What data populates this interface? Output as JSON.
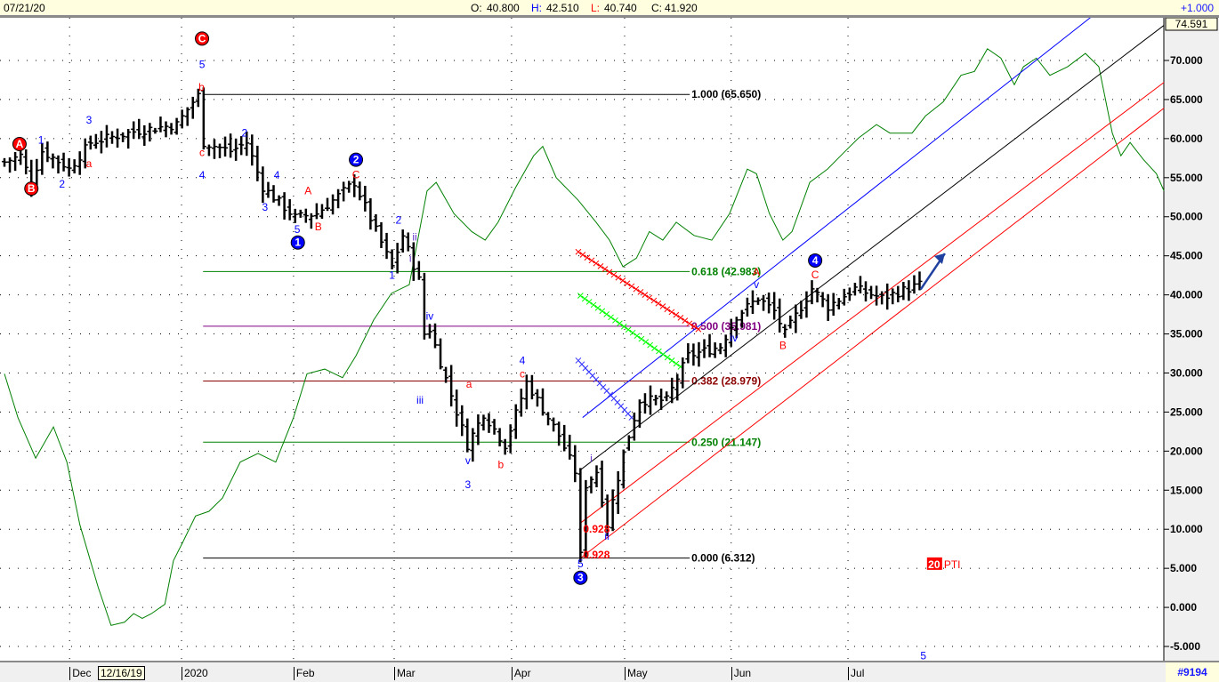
{
  "header": {
    "date": "07/21/20",
    "open_label": "O:",
    "open": "40.800",
    "high_label": "H:",
    "high": "42.510",
    "low_label": "L:",
    "low": "40.740",
    "close_label": "C:",
    "close": "41.920",
    "change": "+1.000"
  },
  "footer": {
    "cursor_date": "12/16/19",
    "series_id": "#9194"
  },
  "chart_data": {
    "type": "ohlc",
    "ylim": [
      -6.3,
      74.591
    ],
    "y_top_label": "74.591",
    "yticks": [
      70,
      65,
      60,
      55,
      50,
      45,
      40,
      35,
      30,
      25,
      20,
      15,
      10,
      5,
      0,
      -5
    ],
    "ytick_labels": [
      "70.000",
      "65.000",
      "60.000",
      "55.000",
      "50.000",
      "45.000",
      "40.000",
      "35.000",
      "30.000",
      "25.000",
      "20.000",
      "15.000",
      "10.000",
      "5.000",
      "0.000",
      "-5.000"
    ],
    "xlim": [
      0,
      215.5
    ],
    "month_ticks": [
      {
        "label": "Dec",
        "idx": 12.1
      },
      {
        "label": "2020",
        "idx": 32.9
      },
      {
        "label": "Feb",
        "idx": 53.7
      },
      {
        "label": "Mar",
        "idx": 72.4
      },
      {
        "label": "Apr",
        "idx": 94.2
      },
      {
        "label": "May",
        "idx": 115.2
      },
      {
        "label": "Jun",
        "idx": 135
      },
      {
        "label": "Jul",
        "idx": 156.7
      }
    ],
    "price_pivots": [
      [
        0,
        57.0
      ],
      [
        3,
        57.8
      ],
      [
        5,
        54.4
      ],
      [
        7,
        58.4
      ],
      [
        11,
        56.7
      ],
      [
        12,
        56.1
      ],
      [
        16,
        59.5
      ],
      [
        24,
        60.9
      ],
      [
        32,
        61.8
      ],
      [
        35,
        64.7
      ],
      [
        36,
        65.5
      ],
      [
        37,
        59.5
      ],
      [
        42,
        58.4
      ],
      [
        45,
        59.5
      ],
      [
        48,
        53.8
      ],
      [
        54,
        49.9
      ],
      [
        58,
        50.4
      ],
      [
        61,
        52.1
      ],
      [
        65,
        54.4
      ],
      [
        72,
        43.6
      ],
      [
        74,
        47.6
      ],
      [
        77,
        41.9
      ],
      [
        78,
        35.0
      ],
      [
        79,
        35.6
      ],
      [
        86,
        20.8
      ],
      [
        89,
        24.8
      ],
      [
        93,
        20.8
      ],
      [
        97,
        28.8
      ],
      [
        103,
        22.0
      ],
      [
        106,
        17.4
      ],
      [
        107,
        6.6
      ],
      [
        108,
        15.7
      ],
      [
        110,
        17.4
      ],
      [
        112,
        10.6
      ],
      [
        115,
        19.7
      ],
      [
        118,
        26.5
      ],
      [
        123,
        26.5
      ],
      [
        127,
        32.2
      ],
      [
        133,
        33.4
      ],
      [
        136,
        37.3
      ],
      [
        140,
        39.6
      ],
      [
        143,
        37.9
      ],
      [
        145,
        35.0
      ],
      [
        150,
        40.8
      ],
      [
        153,
        38.5
      ],
      [
        158,
        40.8
      ],
      [
        163,
        39.6
      ],
      [
        170,
        41.3
      ]
    ],
    "indicator_line": {
      "color": "#008000",
      "points": [
        [
          0,
          29.9
        ],
        [
          2.5,
          24.3
        ],
        [
          5.8,
          19.1
        ],
        [
          9.1,
          23.1
        ],
        [
          11.6,
          18.6
        ],
        [
          14,
          10.6
        ],
        [
          17.4,
          2.6
        ],
        [
          19.8,
          -2.3
        ],
        [
          22.3,
          -1.9
        ],
        [
          24,
          -0.8
        ],
        [
          25.6,
          -1.4
        ],
        [
          27.3,
          -0.8
        ],
        [
          29.8,
          0.4
        ],
        [
          31.4,
          6.0
        ],
        [
          33.1,
          8.3
        ],
        [
          35.5,
          11.7
        ],
        [
          38,
          12.3
        ],
        [
          40.5,
          14.0
        ],
        [
          43.8,
          18.6
        ],
        [
          47.1,
          19.7
        ],
        [
          50.4,
          18.6
        ],
        [
          53.7,
          24.3
        ],
        [
          56.2,
          29.9
        ],
        [
          59.5,
          30.5
        ],
        [
          62.8,
          29.4
        ],
        [
          65.3,
          32.2
        ],
        [
          68.6,
          36.8
        ],
        [
          71.9,
          40.2
        ],
        [
          75.2,
          41.3
        ],
        [
          78.5,
          53.3
        ],
        [
          80.2,
          54.4
        ],
        [
          83.5,
          50.4
        ],
        [
          86.8,
          48.1
        ],
        [
          89.3,
          47.0
        ],
        [
          91.7,
          49.3
        ],
        [
          95,
          53.8
        ],
        [
          98.3,
          57.8
        ],
        [
          100,
          59.0
        ],
        [
          102.5,
          55.0
        ],
        [
          106.6,
          52.1
        ],
        [
          109.9,
          49.3
        ],
        [
          112.4,
          47.0
        ],
        [
          114.9,
          43.6
        ],
        [
          117.4,
          44.7
        ],
        [
          119.8,
          48.1
        ],
        [
          122.3,
          47.0
        ],
        [
          124.8,
          49.3
        ],
        [
          128.1,
          47.6
        ],
        [
          131.4,
          47.0
        ],
        [
          134.7,
          50.4
        ],
        [
          138,
          56.1
        ],
        [
          139.7,
          55.5
        ],
        [
          142.1,
          50.4
        ],
        [
          144.6,
          47.0
        ],
        [
          146.3,
          48.1
        ],
        [
          149.6,
          54.4
        ],
        [
          152.9,
          56.1
        ],
        [
          156.2,
          58.4
        ],
        [
          158.7,
          60.1
        ],
        [
          162,
          61.8
        ],
        [
          164.5,
          60.7
        ],
        [
          168.6,
          60.7
        ],
        [
          171.1,
          62.9
        ],
        [
          174.4,
          64.7
        ],
        [
          177.7,
          68.1
        ],
        [
          180.2,
          68.6
        ],
        [
          182.6,
          71.5
        ],
        [
          185.1,
          70.3
        ],
        [
          187.6,
          66.9
        ],
        [
          189.3,
          69.2
        ],
        [
          191.7,
          70.3
        ],
        [
          194.2,
          68.1
        ],
        [
          197.5,
          69.2
        ],
        [
          200.8,
          70.9
        ],
        [
          203.3,
          69.2
        ],
        [
          205.8,
          60.7
        ],
        [
          207.4,
          57.8
        ],
        [
          209.1,
          59.5
        ],
        [
          211.6,
          57.3
        ],
        [
          214,
          55.5
        ],
        [
          215.4,
          53.3
        ]
      ]
    },
    "fib_levels": [
      {
        "ratio": "1.000",
        "value": 65.65,
        "label": "1.000 (65.650)",
        "color": "#000000",
        "text_color": "#000000"
      },
      {
        "ratio": "0.618",
        "value": 42.983,
        "label": "0.618 (42.983)",
        "color": "#008000",
        "text_color": "#008000"
      },
      {
        "ratio": "0.500",
        "value": 35.981,
        "label": "0.500 (35.981)",
        "color": "#800080",
        "text_color": "#800080"
      },
      {
        "ratio": "0.382",
        "value": 28.979,
        "label": "0.382 (28.979)",
        "color": "#8b0000",
        "text_color": "#8b0000"
      },
      {
        "ratio": "0.250",
        "value": 21.147,
        "label": "0.250 (21.147)",
        "color": "#008000",
        "text_color": "#008000"
      },
      {
        "ratio": "0.000",
        "value": 6.312,
        "label": "0.000 (6.312)",
        "color": "#000000",
        "text_color": "#000000"
      }
    ],
    "fib_range_idx": [
      36.9,
      127.3
    ],
    "channel_lines": [
      {
        "color": "#0000ff",
        "from": [
          107.4,
          24.3
        ],
        "to": [
          205.8,
          77.7
        ]
      },
      {
        "color": "#000000",
        "from": [
          107,
          17.6
        ],
        "to": [
          215.4,
          74.5
        ]
      },
      {
        "color": "#ff0000",
        "from": [
          107,
          10.8
        ],
        "to": [
          215.4,
          67.2
        ]
      },
      {
        "color": "#ff0000",
        "from": [
          107,
          6.3
        ],
        "to": [
          215.4,
          63.9
        ]
      }
    ],
    "speed_lines": [
      {
        "color": "#ff0000",
        "from": [
          106.6,
          45.5
        ],
        "to": [
          128.9,
          35.6
        ]
      },
      {
        "color": "#00ff00",
        "from": [
          107,
          39.9
        ],
        "to": [
          125.6,
          30.8
        ]
      },
      {
        "color": "#3333ff",
        "from": [
          106.6,
          31.6
        ],
        "to": [
          116.5,
          24.3
        ]
      }
    ],
    "projection_arrow": {
      "color": "#2040a0",
      "from": [
        170.2,
        40.7
      ],
      "to": [
        174.7,
        45.3
      ]
    },
    "wave_labels": [
      {
        "idx": 2.8,
        "price": 59.3,
        "text": "A",
        "color": "#ff0000",
        "circled": true
      },
      {
        "idx": 5,
        "price": 53.6,
        "text": "B",
        "color": "#ff0000",
        "circled": true
      },
      {
        "idx": 6.8,
        "price": 59.8,
        "text": "1",
        "color": "#0000ff"
      },
      {
        "idx": 10.7,
        "price": 54.2,
        "text": "2",
        "color": "#0000ff"
      },
      {
        "idx": 15.7,
        "price": 56.8,
        "text": "a",
        "color": "#ff0000"
      },
      {
        "idx": 15.7,
        "price": 62.4,
        "text": "3",
        "color": "#0000ff"
      },
      {
        "idx": 36.7,
        "price": 72.8,
        "text": "C",
        "color": "#ff0000",
        "circled": true
      },
      {
        "idx": 36.7,
        "price": 69.5,
        "text": "5",
        "color": "#0000ff"
      },
      {
        "idx": 36.6,
        "price": 66.6,
        "text": "b",
        "color": "#ff0000"
      },
      {
        "idx": 36.7,
        "price": 58.2,
        "text": "c",
        "color": "#ff0000"
      },
      {
        "idx": 36.7,
        "price": 55.3,
        "text": "4",
        "color": "#0000ff"
      },
      {
        "idx": 44.6,
        "price": 60.7,
        "text": "2",
        "color": "#0000ff"
      },
      {
        "idx": 50.6,
        "price": 55.3,
        "text": "4",
        "color": "#0000ff"
      },
      {
        "idx": 48.4,
        "price": 51.2,
        "text": "3",
        "color": "#0000ff"
      },
      {
        "idx": 56.4,
        "price": 53.3,
        "text": "A",
        "color": "#ff0000"
      },
      {
        "idx": 54.4,
        "price": 48.4,
        "text": "5",
        "color": "#0000ff"
      },
      {
        "idx": 54.5,
        "price": 46.7,
        "text": "1",
        "color": "#0000ff",
        "circled": true
      },
      {
        "idx": 58.3,
        "price": 48.7,
        "text": "B",
        "color": "#ff0000"
      },
      {
        "idx": 65.3,
        "price": 55.4,
        "text": "C",
        "color": "#ff0000"
      },
      {
        "idx": 65.3,
        "price": 57.3,
        "text": "2",
        "color": "#0000ff",
        "circled": true
      },
      {
        "idx": 73.2,
        "price": 49.6,
        "text": "2",
        "color": "#0000ff"
      },
      {
        "idx": 76.2,
        "price": 47.4,
        "text": "ii",
        "color": "#6633cc"
      },
      {
        "idx": 75.4,
        "price": 44.7,
        "text": "i",
        "color": "#6633cc"
      },
      {
        "idx": 72,
        "price": 42.5,
        "text": "1",
        "color": "#0000ff"
      },
      {
        "idx": 79,
        "price": 37.3,
        "text": "iv",
        "color": "#0000ff"
      },
      {
        "idx": 77.2,
        "price": 26.5,
        "text": "iii",
        "color": "#0000ff"
      },
      {
        "idx": 86.3,
        "price": 28.6,
        "text": "a",
        "color": "#ff0000"
      },
      {
        "idx": 86.1,
        "price": 18.8,
        "text": "v",
        "color": "#0000ff"
      },
      {
        "idx": 86.1,
        "price": 15.7,
        "text": "3",
        "color": "#0000ff"
      },
      {
        "idx": 92.2,
        "price": 18.3,
        "text": "b",
        "color": "#ff0000"
      },
      {
        "idx": 96.2,
        "price": 31.6,
        "text": "4",
        "color": "#0000ff"
      },
      {
        "idx": 96.2,
        "price": 29.9,
        "text": "c",
        "color": "#ff0000"
      },
      {
        "idx": 109,
        "price": 19.1,
        "text": "i",
        "color": "#6633cc"
      },
      {
        "idx": 111.9,
        "price": 9.1,
        "text": "ii",
        "color": "#0000ff"
      },
      {
        "idx": 107,
        "price": 5.6,
        "text": "5",
        "color": "#0000ff"
      },
      {
        "idx": 107,
        "price": 3.8,
        "text": "3",
        "color": "#0000ff",
        "circled": true
      },
      {
        "idx": 135.5,
        "price": 34.5,
        "text": "iv",
        "color": "#0000ff"
      },
      {
        "idx": 139.7,
        "price": 41.3,
        "text": "v",
        "color": "#0000ff"
      },
      {
        "idx": 139.7,
        "price": 42.9,
        "text": "A",
        "color": "#ff0000"
      },
      {
        "idx": 144.6,
        "price": 33.5,
        "text": "B",
        "color": "#ff0000"
      },
      {
        "idx": 150.6,
        "price": 42.6,
        "text": "C",
        "color": "#ff0000"
      },
      {
        "idx": 150.6,
        "price": 44.4,
        "text": "4",
        "color": "#0000ff",
        "circled": true
      },
      {
        "idx": 170.7,
        "price": -6.2,
        "text": "5",
        "color": "#0000ff"
      }
    ],
    "ratio_labels": [
      {
        "idx": 107.5,
        "price": 10.0,
        "text": "0.928",
        "color": "#ff0000"
      },
      {
        "idx": 107.5,
        "price": 6.7,
        "text": "0.928",
        "color": "#ff0000"
      }
    ],
    "pti": {
      "idx": 172.7,
      "price": 5.6,
      "value": "20",
      "label": "PTI"
    }
  }
}
